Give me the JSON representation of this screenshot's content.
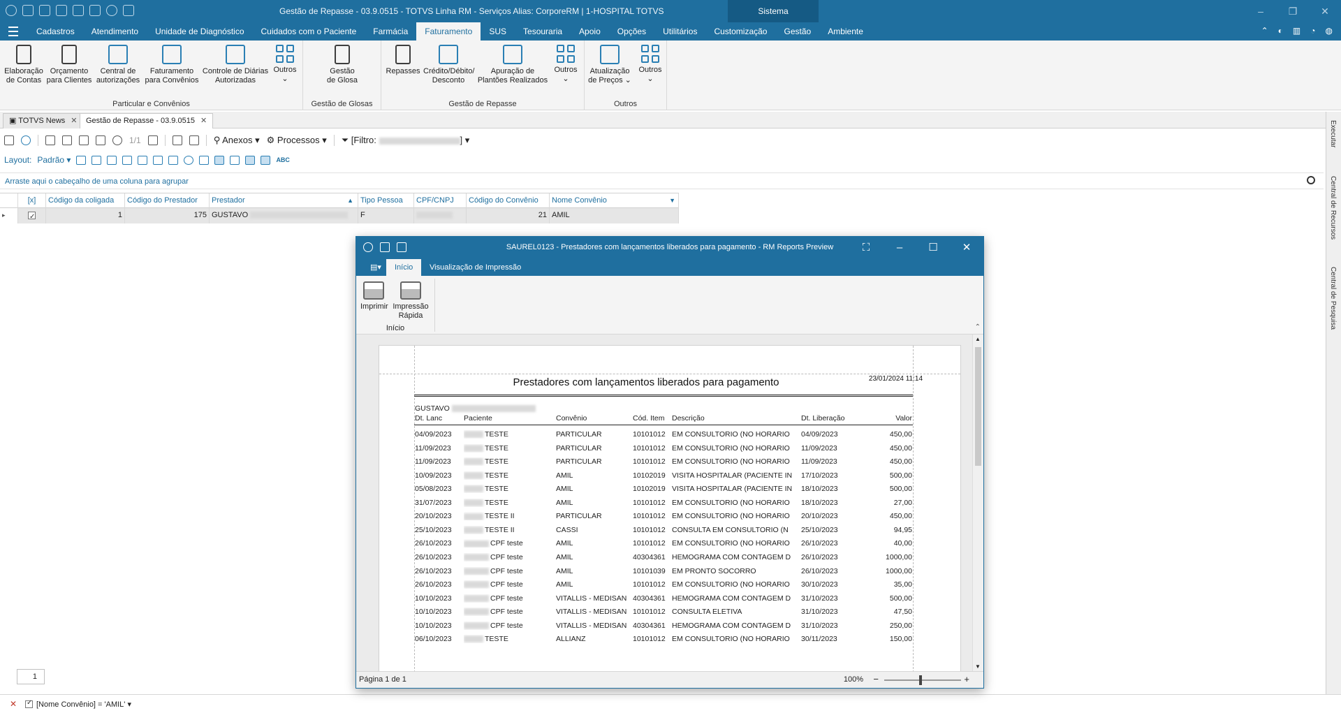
{
  "window": {
    "title": "Gestão de Repasse - 03.9.0515 - TOTVS Linha RM - Serviços  Alias: CorporeRM | 1-HOSPITAL TOTVS",
    "sistema_label": "Sistema"
  },
  "menu": {
    "tabs": [
      "Cadastros",
      "Atendimento",
      "Unidade de Diagnóstico",
      "Cuidados com o Paciente",
      "Farmácia",
      "Faturamento",
      "SUS",
      "Tesouraria",
      "Apoio",
      "Opções",
      "Utilitários",
      "Customização",
      "Gestão",
      "Ambiente"
    ],
    "active": "Faturamento"
  },
  "ribbon": {
    "group1": {
      "label": "Particular e Convênios",
      "buttons": [
        "Elaboração\nde Contas",
        "Orçamento\npara Clientes",
        "Central de\nautorizações",
        "Faturamento\npara Convênios",
        "Controle de Diárias\nAutorizadas",
        "Outros"
      ]
    },
    "group2": {
      "label": "Gestão de Glosas",
      "buttons": [
        "Gestão\nde Glosa"
      ]
    },
    "group3": {
      "label": "Gestão de Repasse",
      "buttons": [
        "Repasses",
        "Crédito/Débito/\nDesconto",
        "Apuração de\nPlantões Realizados",
        "Outros"
      ]
    },
    "group4": {
      "label": "Outros",
      "buttons": [
        "Atualização\nde Preços",
        "Outros"
      ]
    }
  },
  "doc_tabs": [
    "TOTVS News",
    "Gestão de Repasse - 03.9.0515"
  ],
  "toolbar": {
    "page": "1/1",
    "anexos": "Anexos",
    "processos": "Processos",
    "filtro": "[Filtro:",
    "filtro_end": "]",
    "layout_label": "Layout:",
    "layout_value": "Padrão"
  },
  "grouping_hint": "Arraste aqui o cabeçalho de uma coluna para agrupar",
  "grid": {
    "headers": [
      "[x]",
      "Código da coligada",
      "Código do Prestador",
      "Prestador",
      "Tipo Pessoa",
      "CPF/CNPJ",
      "Código do Convênio",
      "Nome Convênio"
    ],
    "row": {
      "coligada": "1",
      "prestador_cod": "175",
      "prestador": "GUSTAVO",
      "tipo": "F",
      "convenio_cod": "21",
      "convenio": "AMIL"
    }
  },
  "side_panel": [
    "Executar",
    "Central de Recursos",
    "Central de Pesquisa"
  ],
  "pager_value": "1",
  "filter_expr": "[Nome Convênio] = 'AMIL'",
  "report_window": {
    "title": "SAUREL0123 - Prestadores com lançamentos liberados para pagamento - RM Reports Preview",
    "tabs": [
      "Início",
      "Visualização de Impressão"
    ],
    "buttons": [
      "Imprimir",
      "Impressão\nRápida"
    ],
    "group_label": "Início",
    "page_info": "Página 1 de 1",
    "zoom": "100%"
  },
  "report": {
    "title": "Prestadores com lançamentos liberados para pagamento",
    "date": "23/01/2024 11:14",
    "prestador": "GUSTAVO",
    "headers": [
      "Dt. Lanc",
      "Paciente",
      "Convênio",
      "Cód. Item",
      "Descrição",
      "Dt. Liberação",
      "Valor"
    ],
    "rows": [
      [
        "04/09/2023",
        "TESTE",
        "PARTICULAR",
        "10101012",
        "EM CONSULTORIO (NO HORARIO",
        "04/09/2023",
        "450,00"
      ],
      [
        "11/09/2023",
        "TESTE",
        "PARTICULAR",
        "10101012",
        "EM CONSULTORIO (NO HORARIO",
        "11/09/2023",
        "450,00"
      ],
      [
        "11/09/2023",
        "TESTE",
        "PARTICULAR",
        "10101012",
        "EM CONSULTORIO (NO HORARIO",
        "11/09/2023",
        "450,00"
      ],
      [
        "10/09/2023",
        "TESTE",
        "AMIL",
        "10102019",
        "VISITA HOSPITALAR (PACIENTE IN",
        "17/10/2023",
        "500,00"
      ],
      [
        "05/08/2023",
        "TESTE",
        "AMIL",
        "10102019",
        "VISITA HOSPITALAR (PACIENTE IN",
        "18/10/2023",
        "500,00"
      ],
      [
        "31/07/2023",
        "TESTE",
        "AMIL",
        "10101012",
        "EM CONSULTORIO (NO HORARIO",
        "18/10/2023",
        "27,00"
      ],
      [
        "20/10/2023",
        "TESTE II",
        "PARTICULAR",
        "10101012",
        "EM CONSULTORIO (NO HORARIO",
        "20/10/2023",
        "450,00"
      ],
      [
        "25/10/2023",
        "TESTE II",
        "CASSI",
        "10101012",
        "CONSULTA EM CONSULTORIO (N",
        "25/10/2023",
        "94,95"
      ],
      [
        "26/10/2023",
        "CPF teste",
        "AMIL",
        "10101012",
        "EM CONSULTORIO (NO HORARIO",
        "26/10/2023",
        "40,00"
      ],
      [
        "26/10/2023",
        "CPF teste",
        "AMIL",
        "40304361",
        "HEMOGRAMA COM CONTAGEM D",
        "26/10/2023",
        "1000,00"
      ],
      [
        "26/10/2023",
        "CPF teste",
        "AMIL",
        "10101039",
        "EM PRONTO SOCORRO",
        "26/10/2023",
        "1000,00"
      ],
      [
        "26/10/2023",
        "CPF teste",
        "AMIL",
        "10101012",
        "EM CONSULTORIO (NO HORARIO",
        "30/10/2023",
        "35,00"
      ],
      [
        "10/10/2023",
        "CPF teste",
        "VITALLIS - MEDISAN",
        "40304361",
        "HEMOGRAMA COM CONTAGEM D",
        "31/10/2023",
        "500,00"
      ],
      [
        "10/10/2023",
        "CPF teste",
        "VITALLIS - MEDISAN",
        "10101012",
        "CONSULTA ELETIVA",
        "31/10/2023",
        "47,50"
      ],
      [
        "10/10/2023",
        "CPF teste",
        "VITALLIS - MEDISAN",
        "40304361",
        "HEMOGRAMA COM CONTAGEM D",
        "31/10/2023",
        "250,00"
      ],
      [
        "06/10/2023",
        "TESTE",
        "ALLIANZ",
        "10101012",
        "EM CONSULTORIO (NO HORARIO",
        "30/11/2023",
        "150,00"
      ]
    ]
  },
  "colors": {
    "accent": "#1f6f9f",
    "ribbon_bg": "#f4f4f4"
  }
}
